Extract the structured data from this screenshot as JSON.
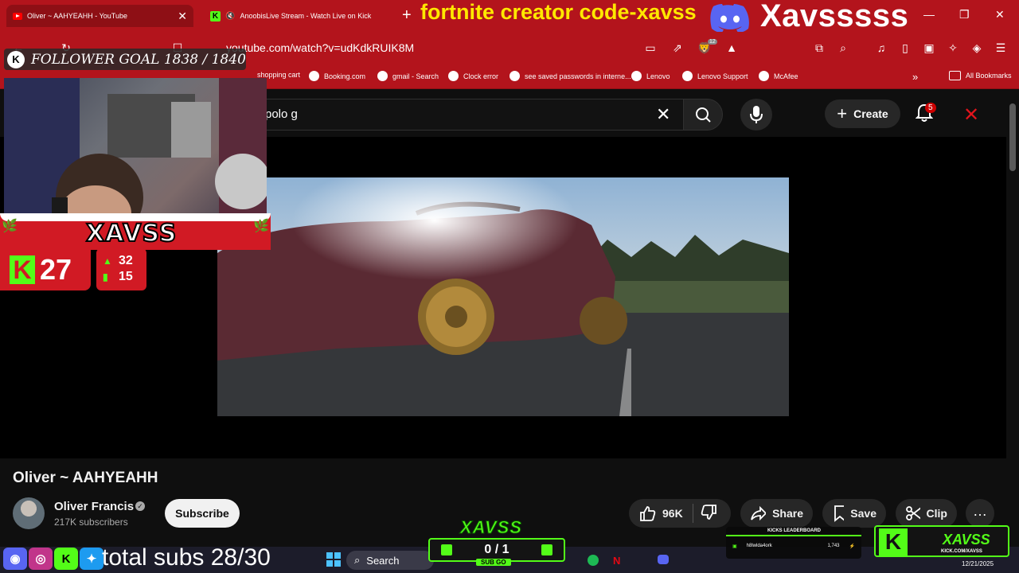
{
  "browser": {
    "tabs": [
      {
        "title": "Oliver ~ AAHYEAHH - YouTube"
      },
      {
        "title": "AnoobisLive Stream - Watch Live on Kick"
      }
    ],
    "url": "youtube.com/watch?v=udKdkRUIK8M",
    "extension_badge": "12",
    "bookmarks": [
      "shopping cart",
      "Booking.com",
      "gmail - Search",
      "Clock error",
      "see saved passwords in interne...",
      "Lenovo",
      "Lenovo Support",
      "McAfee"
    ],
    "all_bookmarks_label": "All Bookmarks"
  },
  "overlay": {
    "title_text": "fortnite creator code-xavss",
    "streamer_name": "Xavsssss",
    "follower_goal": "FOLLOWER GOAL 1838 / 1840",
    "banner_name": "XAVSS",
    "kick_count": "27",
    "stat_up": "32",
    "stat_bars": "15",
    "total_subs": "total subs 28/30",
    "subgoal_title": "XAVSS",
    "subgoal_count": "0 / 1",
    "subgoal_label": "SUB GO",
    "leaderboard_title": "KICKS LEADERBOARD",
    "leaderboard_user": "h8lwlda4ork",
    "leaderboard_value": "1,743",
    "kick_brand_name": "XAVSS",
    "kick_brand_url": "KICK.COM/XAVSS"
  },
  "youtube": {
    "search_value": "polo g",
    "create_label": "Create",
    "notification_count": "5",
    "video_title": "Oliver ~ AAHYEAHH",
    "channel_name": "Oliver Francis",
    "subscriber_count": "217K subscribers",
    "subscribe_label": "Subscribe",
    "like_count": "96K",
    "share_label": "Share",
    "save_label": "Save",
    "clip_label": "Clip"
  },
  "taskbar": {
    "search_label": "Search",
    "date": "12/21/2025"
  },
  "colors": {
    "chrome_red": "#b3141c",
    "kick_green": "#53fc18",
    "overlay_yellow": "#ffe800"
  }
}
